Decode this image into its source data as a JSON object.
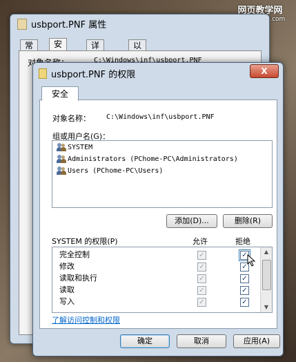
{
  "watermark": {
    "title": "网页教学网",
    "url": "www.webjx.com"
  },
  "back_window": {
    "title": "usbport.PNF 属性",
    "tabs": [
      "常规",
      "安全",
      "详细信息",
      "以前的版本"
    ],
    "partial_label": "对象名称：",
    "partial_value": "C:\\Windows\\inf\\usbport.PNF"
  },
  "dialog": {
    "title": "usbport.PNF 的权限",
    "close_label": "X",
    "tab": "安全",
    "object_label": "对象名称：",
    "object_value": "C:\\Windows\\inf\\usbport.PNF",
    "group_label": "组或用户名(G)：",
    "users": [
      "SYSTEM",
      "Administrators (PChome-PC\\Administrators)",
      "Users (PChome-PC\\Users)"
    ],
    "add_button": "添加(D)...",
    "remove_button": "删除(R)",
    "perm_label": "SYSTEM 的权限(P)",
    "allow_header": "允许",
    "deny_header": "拒绝",
    "permissions": [
      {
        "name": "完全控制",
        "allow": true,
        "deny": true
      },
      {
        "name": "修改",
        "allow": true,
        "deny": true
      },
      {
        "name": "读取和执行",
        "allow": true,
        "deny": true
      },
      {
        "name": "读取",
        "allow": true,
        "deny": true
      },
      {
        "name": "写入",
        "allow": true,
        "deny": true
      }
    ],
    "help_link": "了解访问控制和权限",
    "ok_button": "确定",
    "cancel_button": "取消",
    "apply_button": "应用(A)"
  }
}
